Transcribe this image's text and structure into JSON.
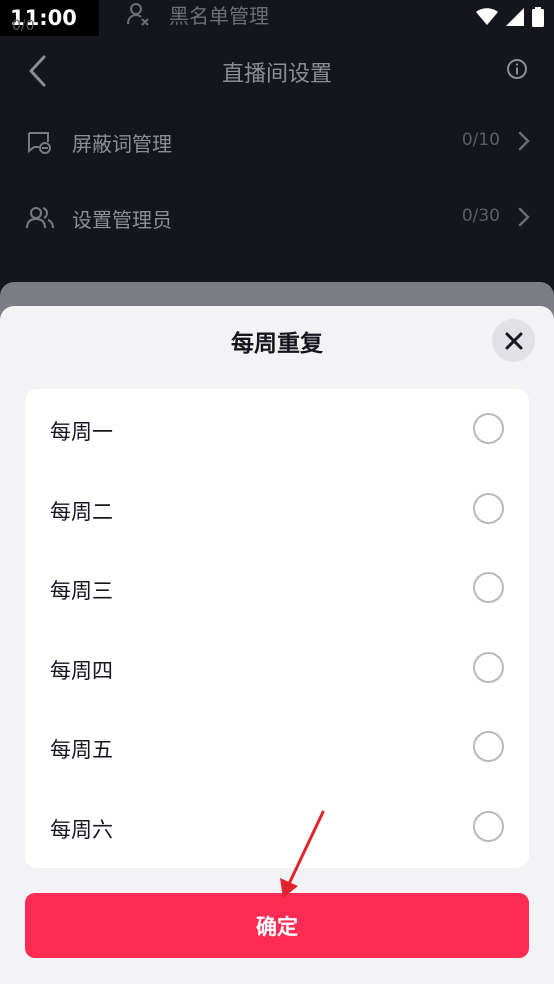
{
  "status_bar": {
    "time": "11:00"
  },
  "background": {
    "blacklist_label": "黑名单管理",
    "count_peek": "0/0",
    "nav_title": "直播间设置",
    "rows": [
      {
        "label": "屏蔽词管理",
        "value": "0/10",
        "icon": "blocked-words-icon"
      },
      {
        "label": "设置管理员",
        "value": "0/30",
        "icon": "admins-icon"
      }
    ]
  },
  "sheet": {
    "title": "每周重复",
    "options": [
      {
        "label": "每周一",
        "checked": false
      },
      {
        "label": "每周二",
        "checked": false
      },
      {
        "label": "每周三",
        "checked": false
      },
      {
        "label": "每周四",
        "checked": false
      },
      {
        "label": "每周五",
        "checked": false
      },
      {
        "label": "每周六",
        "checked": false
      }
    ],
    "confirm_label": "确定"
  },
  "colors": {
    "accent": "#fe2c55",
    "annotation_arrow": "#e0242c"
  }
}
